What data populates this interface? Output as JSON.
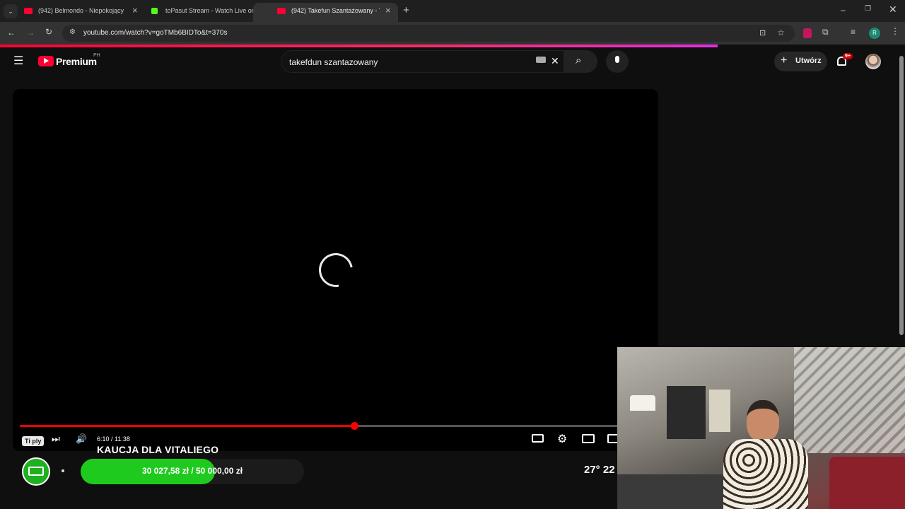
{
  "browser": {
    "tabs": [
      {
        "title": "(942) Belmondo - Niepokojący",
        "favicon_color": "#ff0033"
      },
      {
        "title": "toPasut Stream - Watch Live on",
        "favicon_color": "#53fc18"
      },
      {
        "title": "(942) Takefun Szantażowany - Y",
        "favicon_color": "#ff0033"
      }
    ],
    "new_tab": "+",
    "url": "youtube.com/watch?v=goTMb6BIDTo&t=370s",
    "profile_initial": "R"
  },
  "youtube": {
    "brand": "Premium",
    "region": "PH",
    "search_value": "takefdun szantazowany",
    "create_label": "Utwórz",
    "notif_badge": "9+"
  },
  "player": {
    "progress_fraction": 0.557,
    "time": "6:10 / 11:38",
    "tooltip": "Ti ply"
  },
  "overlay": {
    "title": "KAUCJA DLA VITALIEGO",
    "goal_text": "30 027,58 zł  /  50 000,00 zł",
    "goal_fraction": 0.6,
    "weather": "27° 22"
  },
  "colors": {
    "accent": "#ff0000",
    "goal_green": "#1fca1f"
  }
}
